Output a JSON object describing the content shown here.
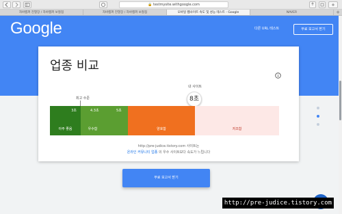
{
  "browser": {
    "url": "testmysite.withgoogle.com",
    "tabs": [
      {
        "label": "자바캠퍼 진열장 / 자바캠퍼 보철점",
        "active": false
      },
      {
        "label": "자바캠퍼 진열장 / 자바캠퍼 보철점",
        "active": false
      },
      {
        "label": "모바일 웹사이트 속도 및 성능 테스트 - Google",
        "active": true
      },
      {
        "label": "NAVER",
        "active": false
      }
    ]
  },
  "header": {
    "logo": "Google",
    "test_link": "다른 URL 테스트",
    "report_button": "무료 보고서 받기"
  },
  "card": {
    "title": "업종 비교",
    "mysite_label": "내 사이트",
    "mysite_value": "8초",
    "reference_label": "최고 수준",
    "segments": [
      {
        "value_label": "3초",
        "name": "아주 좋음",
        "color": "#2e7d1e"
      },
      {
        "value_label": "4.3초",
        "name": "우수함",
        "color": "#5b9e31"
      },
      {
        "value_label": "5초",
        "name": "",
        "color": "#5b9e31"
      },
      {
        "value_label": "",
        "name": "양호함",
        "color": "#f0701f"
      },
      {
        "value_label": "",
        "name": "저조함",
        "color": "#fde8e6"
      }
    ],
    "site_url_line": "http://pre-judice.tistory.com 사이트는",
    "industry": "온라인 커뮤니티 업종",
    "industry_suffix": "의 우수 사이트보다 속도가 느립니다"
  },
  "cta_button": "무료 보고서 받기",
  "watermark": "http://pre-judice.tistory.com",
  "colors": {
    "accent": "#4285f4"
  }
}
